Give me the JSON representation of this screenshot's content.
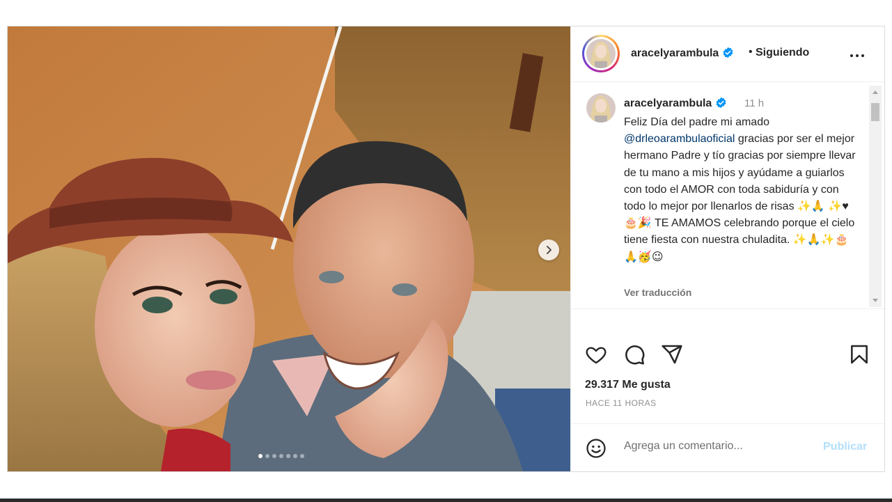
{
  "header": {
    "username": "aracelyarambula",
    "bullet": "•",
    "follow_status": "Siguiendo"
  },
  "caption": {
    "username": "aracelyarambula",
    "time": "11 h",
    "line1": "Feliz Día del padre mi amado",
    "mention": "@drleoarambulaoficial",
    "rest": " gracias por ser el mejor hermano Padre y tío gracias por siempre llevar de tu mano a mis hijos y ayúdame a guiarlos con todo el AMOR con toda sabiduría y con todo lo mejor por llenarlos de risas ✨🙏 ✨♥🎂🎉 TE AMAMOS celebrando porque el cielo tiene fiesta con nuestra chuladita. ✨🙏✨🎂🙏🥳😉",
    "translate": "Ver traducción"
  },
  "stats": {
    "likes": "29.317 Me gusta",
    "time_ago": "HACE 11 HORAS"
  },
  "comment": {
    "placeholder": "Agrega un comentario...",
    "publish": "Publicar"
  },
  "carousel": {
    "slides": 7,
    "active_index": 0
  },
  "icons": {
    "more": "more-options-icon",
    "verified": "verified-badge-icon",
    "like": "heart-icon",
    "comment": "comment-icon",
    "share": "share-icon",
    "save": "bookmark-icon",
    "emoji": "emoji-icon",
    "next": "chevron-right-icon"
  },
  "colors": {
    "verified": "#0095f6",
    "mention": "#00376b",
    "publish_disabled": "#b2dffc"
  }
}
